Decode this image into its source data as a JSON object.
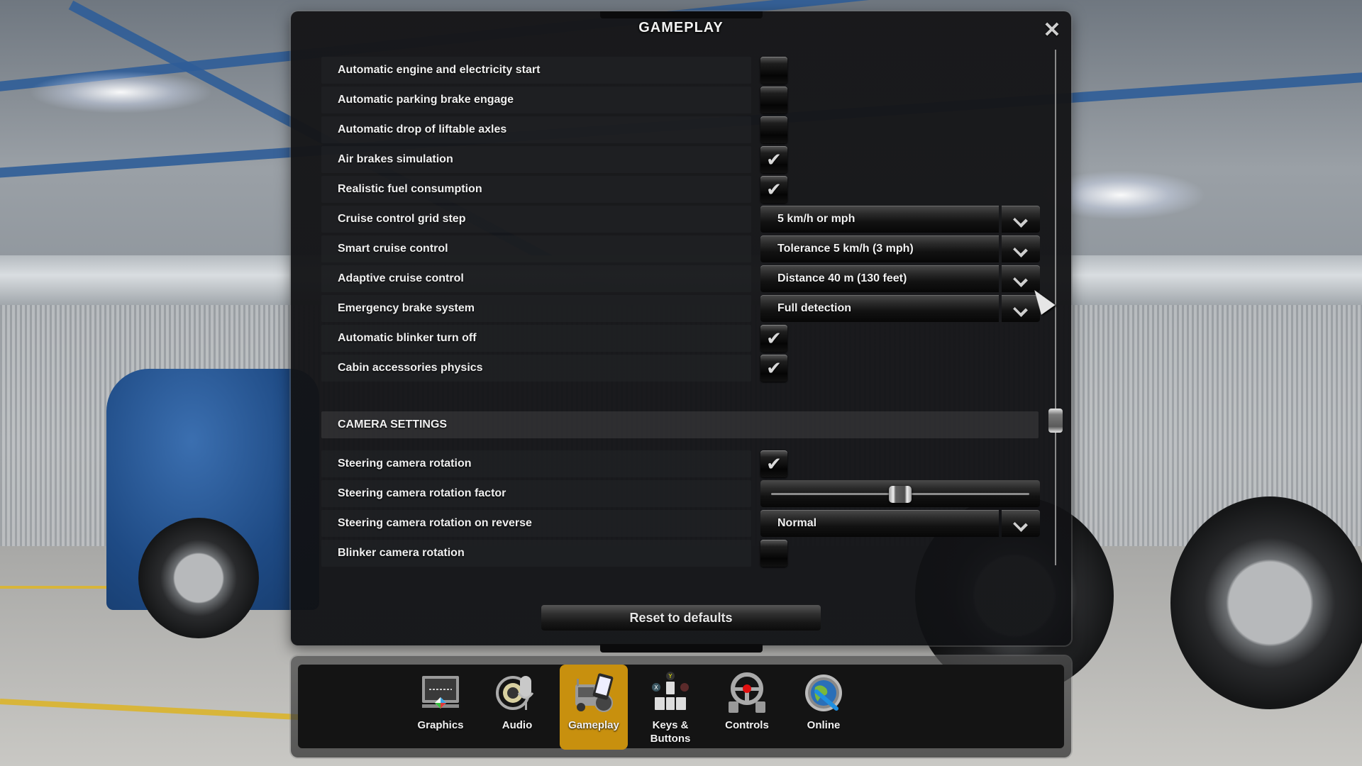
{
  "dialog": {
    "title": "GAMEPLAY",
    "close_label": "✕",
    "reset_label": "Reset to defaults"
  },
  "settings": [
    {
      "label": "Automatic engine and electricity start",
      "type": "checkbox",
      "checked": false
    },
    {
      "label": "Automatic parking brake engage",
      "type": "checkbox",
      "checked": false
    },
    {
      "label": "Automatic drop of liftable axles",
      "type": "checkbox",
      "checked": false
    },
    {
      "label": "Air brakes simulation",
      "type": "checkbox",
      "checked": true
    },
    {
      "label": "Realistic fuel consumption",
      "type": "checkbox",
      "checked": true
    },
    {
      "label": "Cruise control grid step",
      "type": "dropdown",
      "value": "5 km/h or mph"
    },
    {
      "label": "Smart cruise control",
      "type": "dropdown",
      "value": "Tolerance 5 km/h (3 mph)"
    },
    {
      "label": "Adaptive cruise control",
      "type": "dropdown",
      "value": "Distance 40 m (130 feet)"
    },
    {
      "label": "Emergency brake system",
      "type": "dropdown",
      "value": "Full detection"
    },
    {
      "label": "Automatic blinker turn off",
      "type": "checkbox",
      "checked": true
    },
    {
      "label": "Cabin accessories physics",
      "type": "checkbox",
      "checked": true
    }
  ],
  "camera_section": {
    "title": "CAMERA SETTINGS",
    "settings": [
      {
        "label": "Steering camera rotation",
        "type": "checkbox",
        "checked": true
      },
      {
        "label": "Steering camera rotation factor",
        "type": "slider",
        "value_fraction": 0.5
      },
      {
        "label": "Steering camera rotation on reverse",
        "type": "dropdown",
        "value": "Normal"
      },
      {
        "label": "Blinker camera rotation",
        "type": "checkbox",
        "checked": false
      }
    ]
  },
  "scrollbar": {
    "position_fraction": 0.72
  },
  "tabs": [
    {
      "label": "Graphics",
      "icon": "monitor-icon",
      "active": false
    },
    {
      "label": "Audio",
      "icon": "speaker-microphone-icon",
      "active": false
    },
    {
      "label": "Gameplay",
      "icon": "truck-tablet-icon",
      "active": true
    },
    {
      "label": "Keys & Buttons",
      "icon": "keys-buttons-icon",
      "active": false
    },
    {
      "label": "Controls",
      "icon": "steering-wheel-icon",
      "active": false
    },
    {
      "label": "Online",
      "icon": "globe-gear-icon",
      "active": false
    }
  ],
  "colors": {
    "active_tab": "#c8900e",
    "text": "#f0f0f0"
  },
  "glyphs": {
    "check": "✔"
  }
}
